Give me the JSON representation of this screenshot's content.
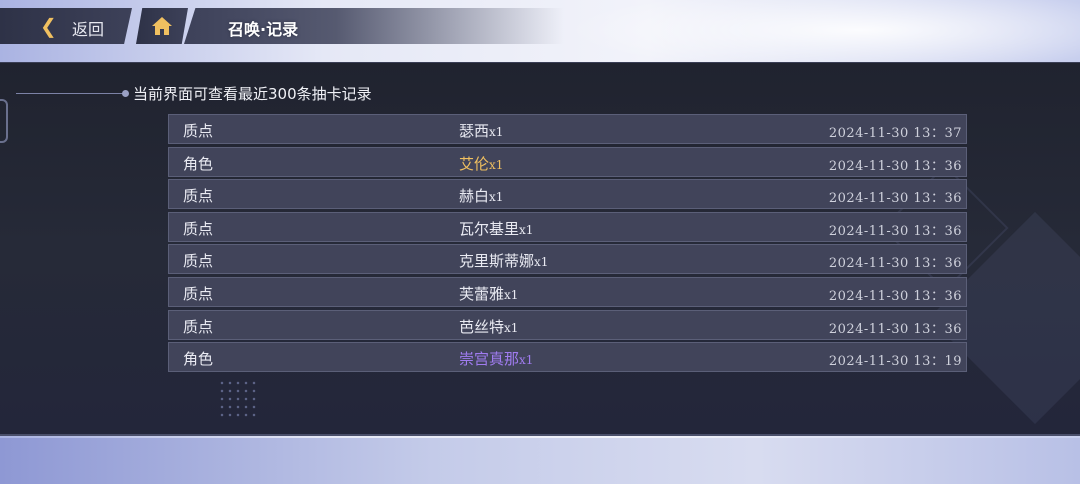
{
  "nav": {
    "back_label": "返回",
    "title": "召唤·记录"
  },
  "notice": "当前界面可查看最近300条抽卡记录",
  "colors": {
    "gold": "#f0c060",
    "purple": "#a07cf0",
    "normal": "#e9eaf2"
  },
  "records": [
    {
      "type": "质点",
      "name": "瑟西",
      "mult": "x1",
      "time": "2024-11-30 13：37",
      "rarity": "normal"
    },
    {
      "type": "角色",
      "name": "艾伦",
      "mult": "x1",
      "time": "2024-11-30 13：36",
      "rarity": "gold"
    },
    {
      "type": "质点",
      "name": "赫白",
      "mult": "x1",
      "time": "2024-11-30 13：36",
      "rarity": "normal"
    },
    {
      "type": "质点",
      "name": "瓦尔基里",
      "mult": "x1",
      "time": "2024-11-30 13：36",
      "rarity": "normal"
    },
    {
      "type": "质点",
      "name": "克里斯蒂娜",
      "mult": "x1",
      "time": "2024-11-30 13：36",
      "rarity": "normal"
    },
    {
      "type": "质点",
      "name": "芙蕾雅",
      "mult": "x1",
      "time": "2024-11-30 13：36",
      "rarity": "normal"
    },
    {
      "type": "质点",
      "name": "芭丝特",
      "mult": "x1",
      "time": "2024-11-30 13：36",
      "rarity": "normal"
    },
    {
      "type": "角色",
      "name": "崇宫真那",
      "mult": "x1",
      "time": "2024-11-30 13：19",
      "rarity": "purple"
    }
  ]
}
